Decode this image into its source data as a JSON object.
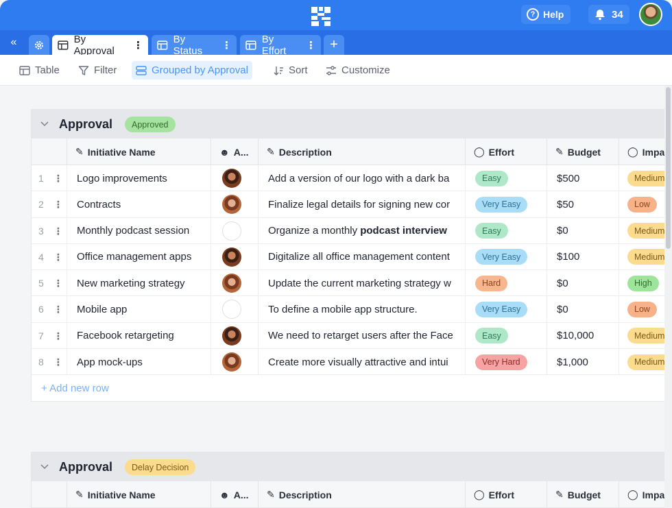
{
  "header": {
    "help_label": "Help",
    "notifications_count": "34"
  },
  "tabs": [
    {
      "label": "By Approval",
      "active": true
    },
    {
      "label": "By Status",
      "active": false
    },
    {
      "label": "By Effort",
      "active": false
    }
  ],
  "toolbar": {
    "table": "Table",
    "filter": "Filter",
    "grouped": "Grouped by Approval",
    "sort": "Sort",
    "customize": "Customize"
  },
  "columns": {
    "name": "Initiative Name",
    "assignee": "A...",
    "description": "Description",
    "effort": "Effort",
    "budget": "Budget",
    "impact": "Impac"
  },
  "colors": {
    "easy": "#aee8c9",
    "very_easy": "#a9dcf6",
    "hard": "#f7b68d",
    "very_hard": "#f6a3a3",
    "medium": "#fbdc8f",
    "low": "#f7b28a",
    "high": "#9fe49b"
  },
  "group1": {
    "title": "Approval",
    "badge": "Approved",
    "rows": [
      {
        "n": "1",
        "name": "Logo improvements",
        "avatar": "a1",
        "desc": "Add a version of our logo with a dark ba",
        "desc_bold": "",
        "effort": "Easy",
        "budget": "$500",
        "impact": "Medium"
      },
      {
        "n": "2",
        "name": "Contracts",
        "avatar": "a2",
        "desc": "Finalize legal details for signing new cor",
        "desc_bold": "",
        "effort": "Very Easy",
        "budget": "$50",
        "impact": "Low"
      },
      {
        "n": "3",
        "name": "Monthly podcast session",
        "avatar": "a3",
        "desc": "Organize a monthly ",
        "desc_bold": "podcast interview",
        "effort": "Easy",
        "budget": "$0",
        "impact": "Medium"
      },
      {
        "n": "4",
        "name": "Office management apps",
        "avatar": "a1",
        "desc": "Digitalize all office management content",
        "desc_bold": "",
        "effort": "Very Easy",
        "budget": "$100",
        "impact": "Medium"
      },
      {
        "n": "5",
        "name": "New marketing strategy",
        "avatar": "a2",
        "desc": "Update the current marketing strategy w",
        "desc_bold": "",
        "effort": "Hard",
        "budget": "$0",
        "impact": "High"
      },
      {
        "n": "6",
        "name": "Mobile app",
        "avatar": "a3",
        "desc": "To define a mobile app structure.",
        "desc_bold": "",
        "effort": "Very Easy",
        "budget": "$0",
        "impact": "Low"
      },
      {
        "n": "7",
        "name": "Facebook retargeting",
        "avatar": "a1",
        "desc": "We need to retarget users after the Face",
        "desc_bold": "",
        "effort": "Easy",
        "budget": "$10,000",
        "impact": "Medium"
      },
      {
        "n": "8",
        "name": "App mock-ups",
        "avatar": "a2",
        "desc": "Create more visually attractive and intui",
        "desc_bold": "",
        "effort": "Very Hard",
        "budget": "$1,000",
        "impact": "Medium"
      }
    ],
    "add_row": "+ Add new row"
  },
  "group2": {
    "title": "Approval",
    "badge": "Delay Decision"
  }
}
